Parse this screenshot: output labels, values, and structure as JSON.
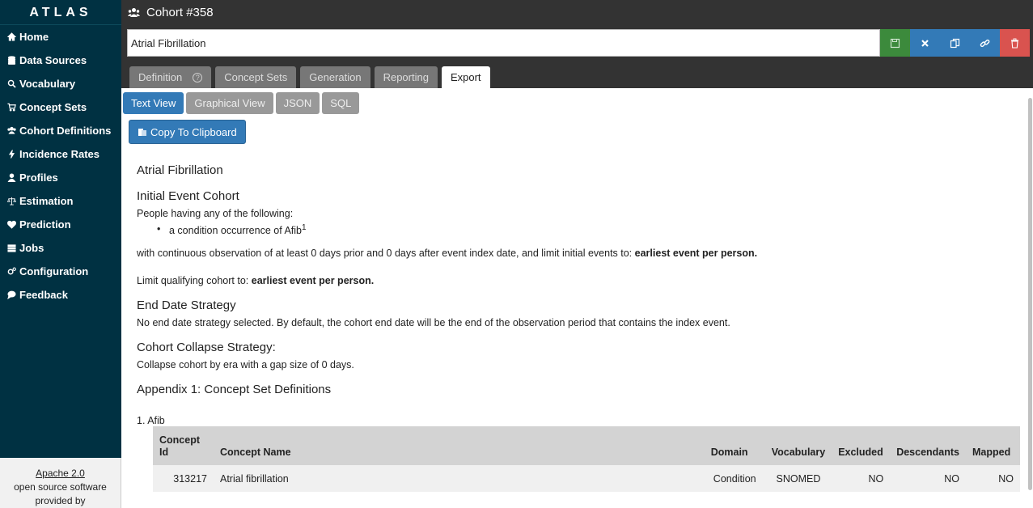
{
  "brand": "ATLAS",
  "sidebar": {
    "items": [
      {
        "label": "Home",
        "icon": "home-icon"
      },
      {
        "label": "Data Sources",
        "icon": "database-icon"
      },
      {
        "label": "Vocabulary",
        "icon": "search-icon"
      },
      {
        "label": "Concept Sets",
        "icon": "cart-icon"
      },
      {
        "label": "Cohort Definitions",
        "icon": "users-icon"
      },
      {
        "label": "Incidence Rates",
        "icon": "bolt-icon"
      },
      {
        "label": "Profiles",
        "icon": "user-icon"
      },
      {
        "label": "Estimation",
        "icon": "balance-icon"
      },
      {
        "label": "Prediction",
        "icon": "heartbeat-icon"
      },
      {
        "label": "Jobs",
        "icon": "list-icon"
      },
      {
        "label": "Configuration",
        "icon": "cogs-icon"
      },
      {
        "label": "Feedback",
        "icon": "comment-icon"
      }
    ],
    "footer": {
      "license_link": "Apache 2.0",
      "license_text": "open source software",
      "provided_by": "provided by"
    }
  },
  "header": {
    "title": "Cohort #358",
    "cohort_name": "Atrial Fibrillation",
    "tabs": [
      {
        "label": "Definition"
      },
      {
        "label": "Concept Sets"
      },
      {
        "label": "Generation"
      },
      {
        "label": "Reporting"
      },
      {
        "label": "Export"
      }
    ],
    "active_tab": "Export"
  },
  "toolbar": {
    "colors": {
      "save": "#3c8a3c",
      "close": "#337ab7",
      "copy": "#337ab7",
      "link": "#337ab7",
      "delete": "#d9534f"
    }
  },
  "export": {
    "subtabs": [
      "Text View",
      "Graphical View",
      "JSON",
      "SQL"
    ],
    "active_subtab": "Text View",
    "copy_button": "Copy To Clipboard"
  },
  "doc": {
    "title": "Atrial Fibrillation",
    "initial_event_heading": "Initial Event Cohort",
    "people_having": "People having any of the following:",
    "bullet_text": "a condition occurrence of Afib",
    "bullet_sup": "1",
    "continuous_obs": "with continuous observation of at least 0 days prior and 0 days after event index date, and limit initial events to:",
    "continuous_obs_bold": "earliest event per person.",
    "limit_qualifying": "Limit qualifying cohort to:",
    "limit_qualifying_bold": "earliest event per person.",
    "end_date_heading": "End Date Strategy",
    "end_date_text": "No end date strategy selected. By default, the cohort end date will be the end of the observation period that contains the index event.",
    "collapse_heading": "Cohort Collapse Strategy:",
    "collapse_text": "Collapse cohort by era with a gap size of 0 days.",
    "appendix_heading": "Appendix 1: Concept Set Definitions",
    "concept_set_item": "1. Afib"
  },
  "concept_table": {
    "headers": [
      "Concept Id",
      "Concept Name",
      "Domain",
      "Vocabulary",
      "Excluded",
      "Descendants",
      "Mapped"
    ],
    "rows": [
      [
        "313217",
        "Atrial fibrillation",
        "Condition",
        "SNOMED",
        "NO",
        "NO",
        "NO"
      ]
    ]
  }
}
